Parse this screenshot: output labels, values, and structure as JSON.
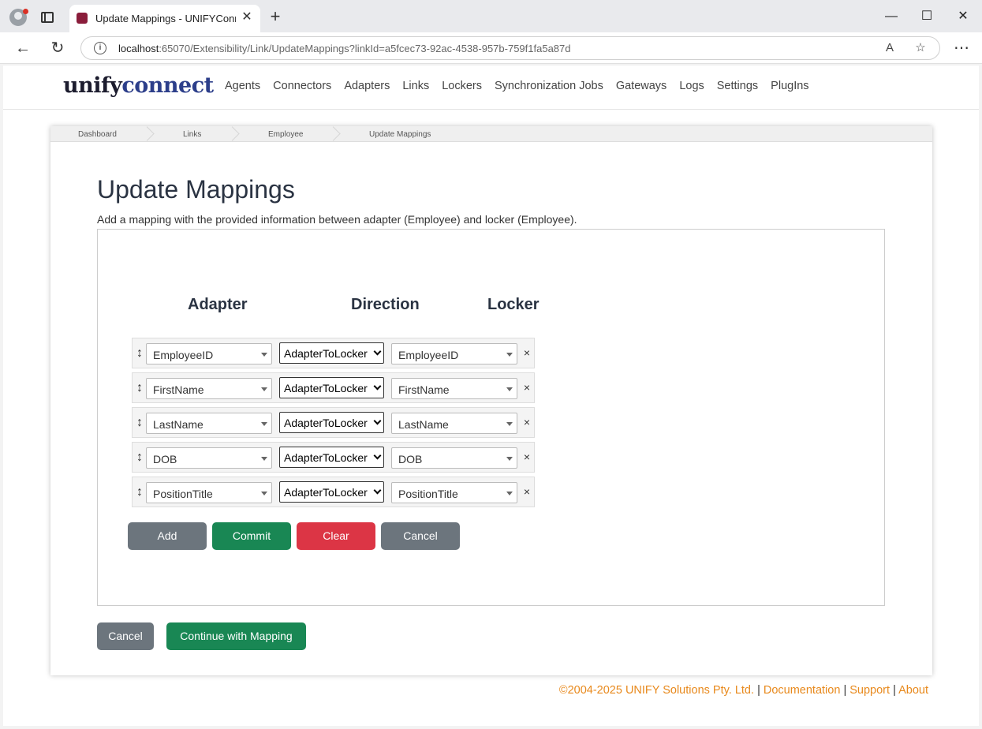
{
  "browser": {
    "tab_title": "Update Mappings - UNIFYConnect",
    "url_host": "localhost",
    "url_rest": ":65070/Extensibility/Link/UpdateMappings?linkId=a5fcec73-92ac-4538-957b-759f1fa5a87d"
  },
  "header": {
    "logo_part1": "unify",
    "logo_part2": "connect",
    "nav": [
      "Agents",
      "Connectors",
      "Adapters",
      "Links",
      "Lockers",
      "Synchronization Jobs",
      "Gateways",
      "Logs",
      "Settings",
      "PlugIns"
    ]
  },
  "breadcrumb": [
    "Dashboard",
    "Links",
    "Employee",
    "Update Mappings"
  ],
  "main": {
    "title": "Update Mappings",
    "description": "Add a mapping with the provided information between adapter (Employee) and locker (Employee).",
    "col_adapter": "Adapter",
    "col_direction": "Direction",
    "col_locker": "Locker",
    "remove_glyph": "×",
    "drag_glyph": "↕"
  },
  "mappings": [
    {
      "adapter": "EmployeeID",
      "direction": "AdapterToLocker",
      "locker": "EmployeeID"
    },
    {
      "adapter": "FirstName",
      "direction": "AdapterToLocker",
      "locker": "FirstName"
    },
    {
      "adapter": "LastName",
      "direction": "AdapterToLocker",
      "locker": "LastName"
    },
    {
      "adapter": "DOB",
      "direction": "AdapterToLocker",
      "locker": "DOB"
    },
    {
      "adapter": "PositionTitle",
      "direction": "AdapterToLocker",
      "locker": "PositionTitle"
    }
  ],
  "mapping_buttons": {
    "add": "Add",
    "commit": "Commit",
    "clear": "Clear",
    "cancel": "Cancel"
  },
  "form_buttons": {
    "cancel": "Cancel",
    "continue": "Continue with Mapping"
  },
  "footer": {
    "copyright": "©2004-2025 UNIFY Solutions Pty. Ltd.",
    "sep": "|",
    "documentation": "Documentation",
    "support": "Support",
    "about": "About"
  },
  "colors": {
    "primary_green": "#198754",
    "danger_red": "#dc3545",
    "secondary_gray": "#6c757d",
    "footer_link": "#e8891c"
  }
}
